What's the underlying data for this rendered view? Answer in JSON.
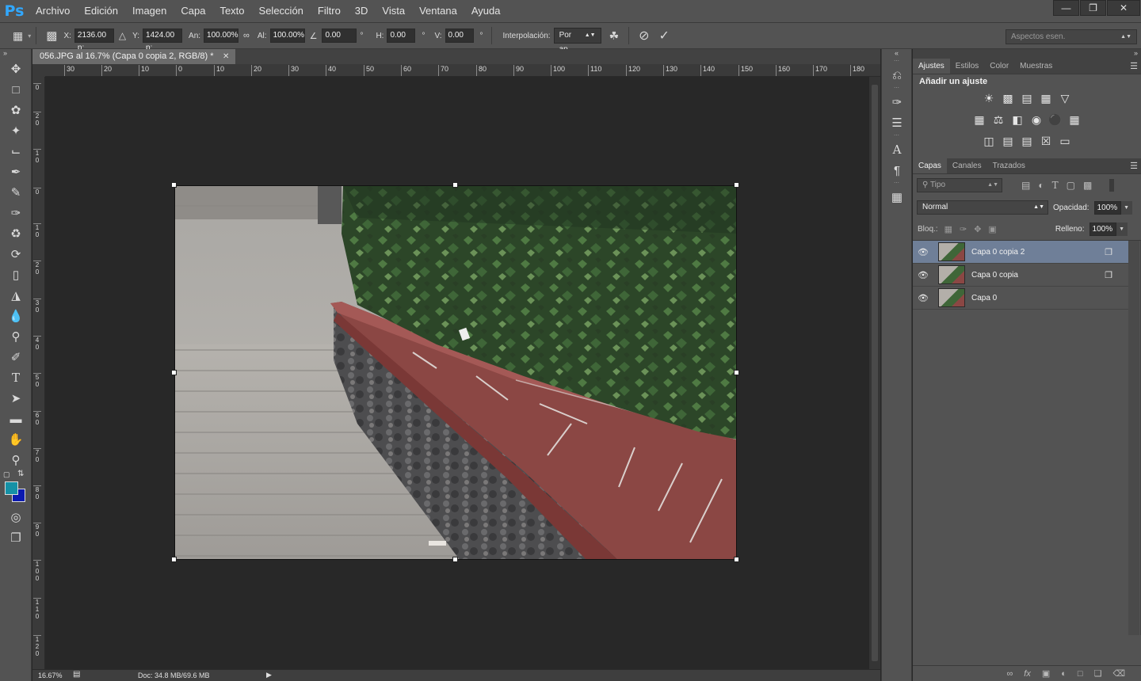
{
  "menubar": {
    "logo": "Ps",
    "items": [
      "Archivo",
      "Edición",
      "Imagen",
      "Capa",
      "Texto",
      "Selección",
      "Filtro",
      "3D",
      "Vista",
      "Ventana",
      "Ayuda"
    ],
    "window_controls": [
      "minimize-icon",
      "restore-icon",
      "close-icon"
    ]
  },
  "optbar": {
    "x_label": "X:",
    "x_value": "2136.00 p:",
    "y_label": "Y:",
    "y_value": "1424.00 p:",
    "w_label": "An:",
    "w_value": "100.00%",
    "h_label": "Al:",
    "h_value": "100.00%",
    "angle_value": "0.00",
    "deg": "°",
    "hskew_label": "H:",
    "hskew_value": "0.00",
    "vskew_label": "V:",
    "vskew_value": "0.00",
    "interp_label": "Interpolación:",
    "interp_value": "Por ap...",
    "workspace": "Aspectos esen."
  },
  "document": {
    "tab_title": "056.JPG al 16.7% (Capa 0 copia 2, RGB/8) *",
    "ruler_h": [
      "30",
      "20",
      "10",
      "0",
      "10",
      "20",
      "30",
      "40",
      "50",
      "60",
      "70",
      "80",
      "90",
      "100",
      "110",
      "120",
      "130",
      "140",
      "150",
      "160",
      "170",
      "180"
    ],
    "ruler_v": [
      "0",
      "2 0",
      "1 0",
      "0",
      "1 0",
      "2 0",
      "3 0",
      "4 0",
      "5 0",
      "6 0",
      "7 0",
      "8 0",
      "9 0",
      "1 0 0",
      "1 1 0",
      "1 2 0"
    ],
    "zoom": "16.67%",
    "doc_info": "Doc: 34.8 MB/69.6 MB"
  },
  "adjustments_panel": {
    "tabs": [
      "Ajustes",
      "Estilos",
      "Color",
      "Muestras"
    ],
    "title": "Añadir un ajuste"
  },
  "layers_panel": {
    "tabs": [
      "Capas",
      "Canales",
      "Trazados"
    ],
    "filter_label": "Tipo",
    "blend_mode": "Normal",
    "opacity_label": "Opacidad:",
    "opacity_value": "100%",
    "lock_label": "Bloq.:",
    "fill_label": "Relleno:",
    "fill_value": "100%",
    "layers": [
      {
        "name": "Capa 0 copia 2",
        "selected": true,
        "smart": true
      },
      {
        "name": "Capa 0 copia",
        "selected": false,
        "smart": true
      },
      {
        "name": "Capa 0",
        "selected": false,
        "smart": false
      }
    ]
  },
  "colors": {
    "foreground": "#1591a6",
    "background": "#0b1ab0",
    "selected_layer": "#6f7f98"
  }
}
